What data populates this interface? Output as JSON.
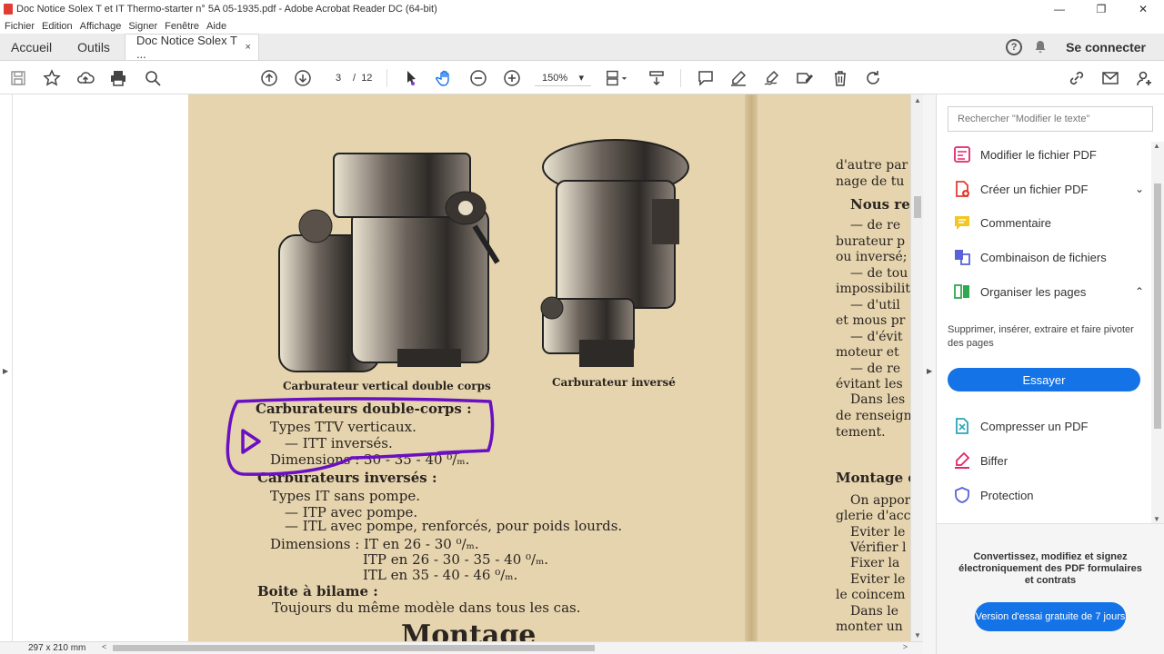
{
  "window": {
    "title": "Doc Notice Solex T et IT Thermo-starter n° 5A  05-1935.pdf - Adobe Acrobat Reader DC (64-bit)",
    "min": "—",
    "max": "❐",
    "close": "✕"
  },
  "menu": [
    "Fichier",
    "Edition",
    "Affichage",
    "Signer",
    "Fenêtre",
    "Aide"
  ],
  "tabs": {
    "home": "Accueil",
    "tools": "Outils",
    "doc": "Doc Notice Solex T ...",
    "close": "×"
  },
  "header": {
    "help": "?",
    "signin": "Se connecter"
  },
  "toolbar": {
    "page_current": "3",
    "page_sep": "/",
    "page_total": "12",
    "zoom": "150%",
    "zoom_caret": "▾"
  },
  "page_text": {
    "caption_left": "Carburateur vertical double corps",
    "caption_right": "Carburateur inversé",
    "h_double": "Carburateurs double-corps :",
    "l1": "Types TTV verticaux.",
    "l2": "—   ITT inversés.",
    "l3": "Dimensions : 30 - 35 - 40 ⁰/ₘ.",
    "h_inv": "Carburateurs inversés :",
    "l4": "Types IT sans pompe.",
    "l5": "—   ITP avec pompe.",
    "l6": "—   ITL avec pompe, renforcés, pour poids lourds.",
    "l7": "Dimensions : IT en 26 - 30 ⁰/ₘ.",
    "l8": "ITP en 26 - 30 - 35 - 40 ⁰/ₘ.",
    "l9": "ITL en 35 - 40 - 46 ⁰/ₘ.",
    "h_boite": "Boite à bilame :",
    "l10": "Toujours du même modèle dans tous les cas.",
    "h_montage": "Montage",
    "r1": "d'autre par",
    "r2": "nage de tu",
    "r3": "Nous re",
    "r4": "— de re",
    "r5": "burateur p",
    "r6": "ou inversé;",
    "r7": "— de tou",
    "r8": "impossibilit",
    "r9": "— d'util",
    "r10": "et mous pr",
    "r11": "— d'évit",
    "r12": "moteur et",
    "r13": "— de re",
    "r14": "évitant les",
    "r15": "Dans les",
    "r16": "de renseign",
    "r17": "tement.",
    "r18": "Montage d",
    "r19": "On appor",
    "r20": "glerie d'acc",
    "r21": "Eviter le",
    "r22": "Vérifier l",
    "r23": "Fixer la",
    "r24": "Eviter le",
    "r25": "le coincem",
    "r26": "Dans le",
    "r27": "monter un"
  },
  "status": {
    "dims": "297 x 210 mm",
    "left": "<",
    "right": ">"
  },
  "right_pane": {
    "search_placeholder": "Rechercher \"Modifier le texte\"",
    "tools": [
      {
        "label": "Modifier le fichier PDF",
        "icon": "edit-pdf-icon"
      },
      {
        "label": "Créer un fichier PDF",
        "icon": "create-pdf-icon"
      },
      {
        "label": "Commentaire",
        "icon": "comment-icon"
      },
      {
        "label": "Combinaison de fichiers",
        "icon": "combine-icon"
      },
      {
        "label": "Organiser les pages",
        "icon": "organize-icon"
      },
      {
        "label": "Compresser un PDF",
        "icon": "compress-icon"
      },
      {
        "label": "Biffer",
        "icon": "redact-icon"
      },
      {
        "label": "Protection",
        "icon": "shield-icon"
      }
    ],
    "chev_down": "⌄",
    "chev_up": "⌃",
    "organize_desc": "Supprimer, insérer, extraire et faire pivoter des pages",
    "try_label": "Essayer",
    "promo_text": "Convertissez, modifiez et signez électroniquement des PDF formulaires et contrats",
    "trial_label": "Version d'essai gratuite de 7 jours"
  },
  "colors": {
    "accent": "#1473e6",
    "annotation": "#6a0fc2",
    "paper": "#e5d4ae"
  }
}
